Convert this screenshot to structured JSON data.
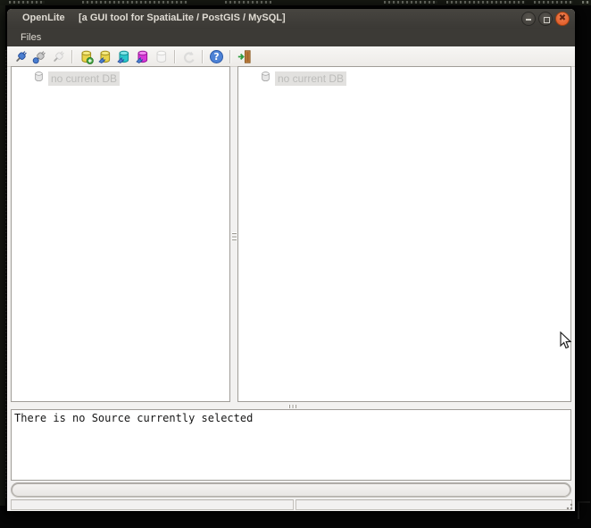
{
  "window": {
    "app_name": "OpenLite",
    "title_suffix": "[a GUI tool for SpatiaLite / PostGIS / MySQL]",
    "controls": [
      {
        "name": "minimize"
      },
      {
        "name": "maximize"
      },
      {
        "name": "close"
      }
    ]
  },
  "menubar": {
    "items": [
      {
        "label": "Files"
      }
    ]
  },
  "toolbar": {
    "buttons": [
      {
        "name": "connect-db",
        "icon": "plug-blue-icon",
        "enabled": true,
        "sep_after": false
      },
      {
        "name": "disconnect-db",
        "icon": "plug-eject-icon",
        "enabled": true,
        "sep_after": false
      },
      {
        "name": "detach-db",
        "icon": "plug-gray-icon",
        "enabled": false,
        "sep_after": true
      },
      {
        "name": "create-new-sqlite-db",
        "icon": "db-yellow-plus-icon",
        "enabled": true,
        "sep_after": false
      },
      {
        "name": "connect-sqlite-db",
        "icon": "db-yellow-plug-icon",
        "enabled": true,
        "sep_after": false
      },
      {
        "name": "connect-postgis-db",
        "icon": "db-cyan-plug-icon",
        "enabled": true,
        "sep_after": false
      },
      {
        "name": "connect-mysql-db",
        "icon": "db-magenta-plug-icon",
        "enabled": true,
        "sep_after": false
      },
      {
        "name": "memory-db",
        "icon": "db-gray-icon",
        "enabled": false,
        "sep_after": true
      },
      {
        "name": "refresh",
        "icon": "refresh-gray-icon",
        "enabled": false,
        "sep_after": true
      },
      {
        "name": "help-about",
        "icon": "help-blue-icon",
        "enabled": true,
        "sep_after": true
      },
      {
        "name": "quit",
        "icon": "exit-door-icon",
        "enabled": true,
        "sep_after": false
      }
    ]
  },
  "panels": {
    "left": {
      "items": [
        {
          "label": "no current DB",
          "icon": "db-cylinder-icon"
        }
      ]
    },
    "right": {
      "items": [
        {
          "label": "no current DB",
          "icon": "db-cylinder-icon"
        }
      ]
    }
  },
  "console": {
    "message": "There is no Source currently selected"
  },
  "statusbar": {
    "left_text": "",
    "right_text": ""
  },
  "colors": {
    "titlebar_bg": "#3c3a36",
    "toolbar_bg": "#f2f1f0",
    "close_button": "#dd5420",
    "selection_bg": "#e2e1df",
    "selection_text": "#bcbcba",
    "db_yellow": "#e9d44a",
    "db_cyan": "#2cc6cb",
    "db_magenta": "#d837d8",
    "plug_blue": "#4a7ed0",
    "help_blue": "#4d82d6"
  }
}
